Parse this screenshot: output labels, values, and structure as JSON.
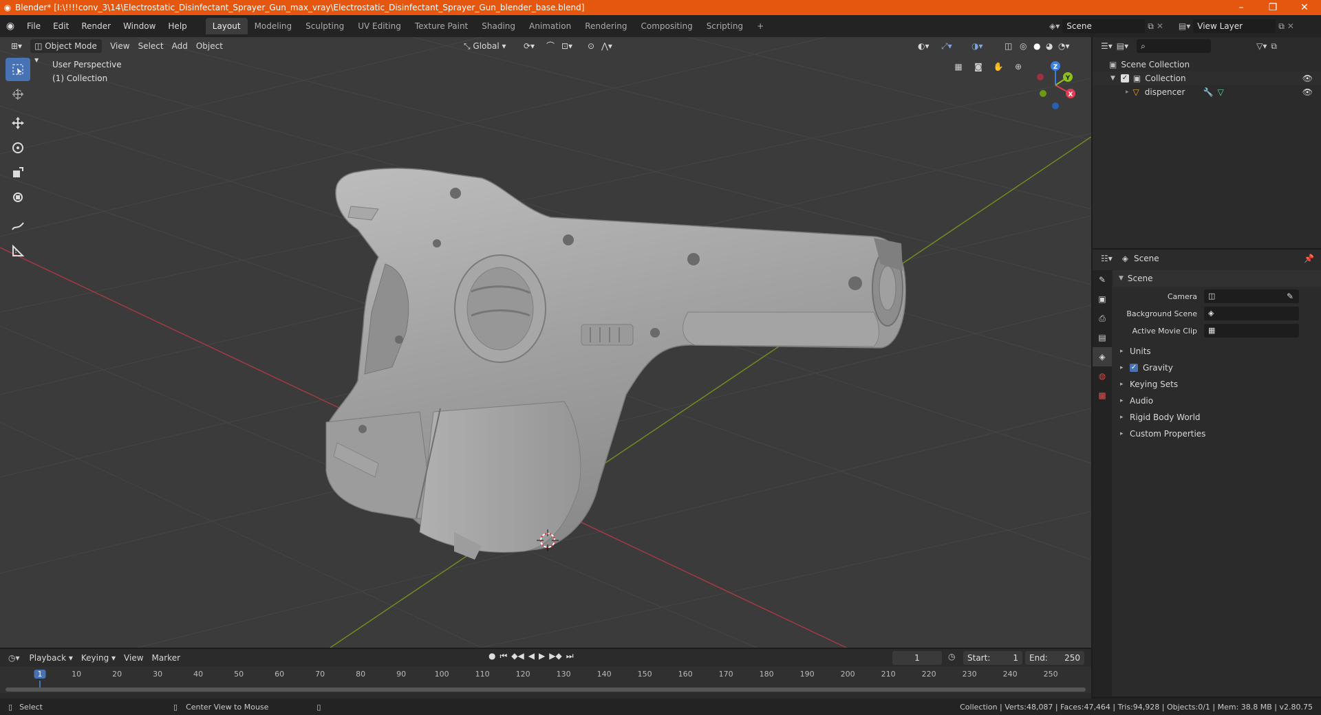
{
  "window": {
    "title": "Blender* [I:\\!!!!conv_3\\14\\Electrostatic_Disinfectant_Sprayer_Gun_max_vray\\Electrostatic_Disinfectant_Sprayer_Gun_blender_base.blend]",
    "minimize": "–",
    "maximize": "❐",
    "close": "✕"
  },
  "menu": [
    "File",
    "Edit",
    "Render",
    "Window",
    "Help"
  ],
  "workspaces": [
    "Layout",
    "Modeling",
    "Sculpting",
    "UV Editing",
    "Texture Paint",
    "Shading",
    "Animation",
    "Rendering",
    "Compositing",
    "Scripting"
  ],
  "add_workspace": "+",
  "scene": {
    "label": "Scene",
    "view_layer": "View Layer"
  },
  "viewport": {
    "mode": "Object Mode",
    "menus": [
      "View",
      "Select",
      "Add",
      "Object"
    ],
    "orientation": "Global",
    "overlay_line1": "User Perspective",
    "overlay_line2": "(1) Collection"
  },
  "gizmo": {
    "x": "X",
    "y": "Y",
    "z": "Z"
  },
  "outliner": {
    "root": "Scene Collection",
    "collection": "Collection",
    "object": "dispencer"
  },
  "properties": {
    "header": "Scene",
    "panel": "Scene",
    "fields": [
      {
        "label": "Camera"
      },
      {
        "label": "Background Scene"
      },
      {
        "label": "Active Movie Clip"
      }
    ],
    "sections": [
      "Units",
      "Gravity",
      "Keying Sets",
      "Audio",
      "Rigid Body World",
      "Custom Properties"
    ]
  },
  "timeline": {
    "menus": [
      "Playback",
      "Keying",
      "View",
      "Marker"
    ],
    "current_frame": "1",
    "start_label": "Start:",
    "start": "1",
    "end_label": "End:",
    "end": "250",
    "ticks": [
      "1",
      "10",
      "20",
      "30",
      "40",
      "50",
      "60",
      "70",
      "80",
      "90",
      "100",
      "110",
      "120",
      "130",
      "140",
      "150",
      "160",
      "170",
      "180",
      "190",
      "200",
      "210",
      "220",
      "230",
      "240",
      "250"
    ]
  },
  "status": {
    "select": "Select",
    "center": "Center View to Mouse",
    "stats": "Collection | Verts:48,087 | Faces:47,464 | Tris:94,928 | Objects:0/1 | Mem: 38.8 MB | v2.80.75"
  },
  "colors": {
    "accent": "#4772b3",
    "titlebar": "#e5560f",
    "x_axis": "#e23c52",
    "y_axis": "#8ec11b",
    "z_axis": "#3c7fe2"
  }
}
